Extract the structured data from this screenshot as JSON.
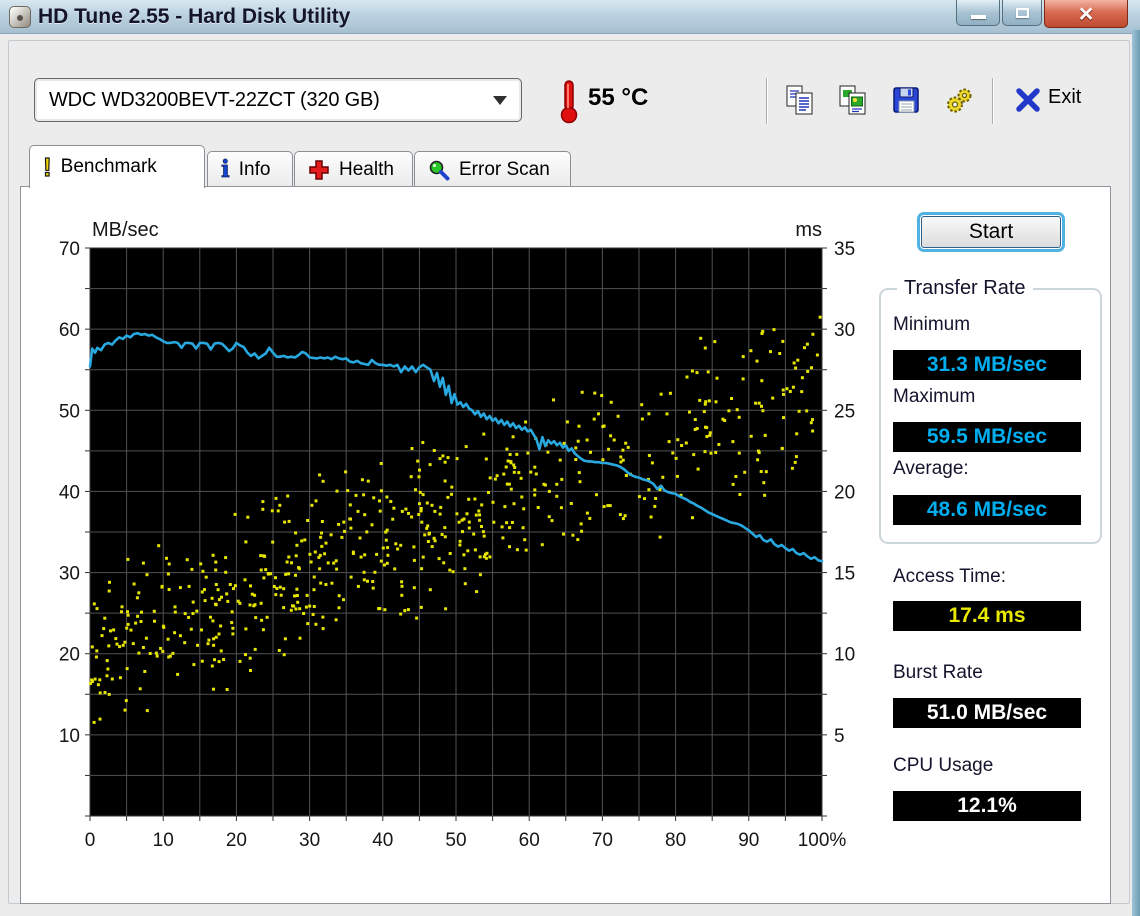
{
  "window": {
    "title": "HD Tune 2.55 - Hard Disk Utility",
    "controls": [
      {
        "name": "minimize"
      },
      {
        "name": "maximize"
      },
      {
        "name": "close"
      }
    ]
  },
  "toolbar": {
    "drive_select": {
      "value": "WDC WD3200BEVT-22ZCT (320 GB)"
    },
    "temperature": {
      "value": "55 °C"
    },
    "buttons": [
      {
        "name": "copy-text"
      },
      {
        "name": "copy-image"
      },
      {
        "name": "save-screenshot"
      },
      {
        "name": "options"
      }
    ],
    "exit_label": "Exit"
  },
  "icons": {
    "app": "hard-disk-icon",
    "temperature": "thermometer-icon",
    "toolbar": [
      "copy-text-icon",
      "copy-image-icon",
      "save-icon",
      "options-gears-icon"
    ],
    "exit": "exit-x-icon",
    "tabs": [
      "exclamation-icon",
      "info-icon",
      "health-cross-icon",
      "error-scan-magnifier-icon"
    ]
  },
  "tabs": [
    {
      "label": "Benchmark",
      "active": true
    },
    {
      "label": "Info",
      "active": false
    },
    {
      "label": "Health",
      "active": false
    },
    {
      "label": "Error Scan",
      "active": false
    }
  ],
  "benchmark": {
    "start_label": "Start",
    "transfer_rate": {
      "title": "Transfer Rate",
      "items": [
        {
          "label": "Minimum",
          "value": "31.3 MB/sec"
        },
        {
          "label": "Maximum",
          "value": "59.5 MB/sec"
        },
        {
          "label": "Average:",
          "value": "48.6 MB/sec"
        }
      ]
    },
    "stats": [
      {
        "label": "Access Time:",
        "value": "17.4 ms"
      },
      {
        "label": "Burst Rate",
        "value": "51.0 MB/sec"
      },
      {
        "label": "CPU Usage",
        "value": "12.1%"
      }
    ]
  },
  "chart_data": {
    "type": "line+scatter",
    "title": "HD Tune read benchmark",
    "left_axis": {
      "label": "MB/sec",
      "min": 0,
      "max": 70,
      "ticks": [
        70,
        60,
        50,
        40,
        30,
        20,
        10
      ]
    },
    "right_axis": {
      "label": "ms",
      "min": 0,
      "max": 35,
      "ticks": [
        35,
        30,
        25,
        20,
        15,
        10,
        5
      ]
    },
    "x_axis": {
      "min": 0,
      "max": 100,
      "ticks": [
        "0",
        "10",
        "20",
        "30",
        "40",
        "50",
        "60",
        "70",
        "80",
        "90",
        "100%"
      ]
    },
    "grid_step_x": 5,
    "grid_step_y": 5,
    "colors": {
      "bg": "#000000",
      "grid": "#525252"
    },
    "results": {
      "minimum_mbsec": 31.3,
      "maximum_mbsec": 59.5,
      "average_mbsec": 48.6,
      "access_time_ms": 17.4,
      "burst_rate_mbsec": 51.0,
      "cpu_usage_pct": 12.1
    },
    "transfer_line": {
      "name": "transfer-rate",
      "unit": "MB/sec",
      "color": "#29a8e0",
      "points": [
        [
          0,
          55.4
        ],
        [
          0.3,
          57.6
        ],
        [
          0.7,
          57.1
        ],
        [
          1,
          57.7
        ],
        [
          1.5,
          57.4
        ],
        [
          2,
          58.1
        ],
        [
          2.5,
          58.3
        ],
        [
          3,
          58.1
        ],
        [
          3.5,
          58.6
        ],
        [
          4,
          59.0
        ],
        [
          4.5,
          58.8
        ],
        [
          5,
          59.2
        ],
        [
          5.5,
          59.0
        ],
        [
          6,
          59.4
        ],
        [
          6.5,
          59.5
        ],
        [
          7,
          59.3
        ],
        [
          7.5,
          59.4
        ],
        [
          8,
          59.2
        ],
        [
          8.5,
          59.3
        ],
        [
          9,
          59.0
        ],
        [
          9.5,
          58.8
        ],
        [
          10,
          58.5
        ],
        [
          10.5,
          58.3
        ],
        [
          11,
          58.3
        ],
        [
          11.5,
          58.4
        ],
        [
          12,
          58.3
        ],
        [
          12.5,
          57.7
        ],
        [
          13,
          58.3
        ],
        [
          13.5,
          58.3
        ],
        [
          14,
          58.2
        ],
        [
          14.5,
          57.6
        ],
        [
          15,
          58.3
        ],
        [
          15.5,
          58.3
        ],
        [
          16,
          58.2
        ],
        [
          16.5,
          57.5
        ],
        [
          17,
          58.2
        ],
        [
          17.5,
          58.3
        ],
        [
          18,
          58.2
        ],
        [
          18.5,
          57.8
        ],
        [
          19,
          57.3
        ],
        [
          19.5,
          57.6
        ],
        [
          20,
          58.3
        ],
        [
          20.5,
          58.0
        ],
        [
          21,
          57.8
        ],
        [
          21.5,
          57.1
        ],
        [
          22,
          56.7
        ],
        [
          22.5,
          57.0
        ],
        [
          23,
          56.4
        ],
        [
          23.5,
          56.7
        ],
        [
          24,
          57.0
        ],
        [
          24.5,
          57.7
        ],
        [
          25,
          57.1
        ],
        [
          25.5,
          56.6
        ],
        [
          26,
          56.6
        ],
        [
          26.5,
          56.7
        ],
        [
          27,
          56.5
        ],
        [
          27.5,
          56.6
        ],
        [
          28,
          56.5
        ],
        [
          28.5,
          56.8
        ],
        [
          29,
          57.2
        ],
        [
          29.5,
          57.0
        ],
        [
          30,
          56.5
        ],
        [
          31,
          56.4
        ],
        [
          31.5,
          56.5
        ],
        [
          32,
          56.4
        ],
        [
          32.5,
          56.5
        ],
        [
          33,
          56.3
        ],
        [
          33.5,
          56.6
        ],
        [
          34,
          56.4
        ],
        [
          34.5,
          56.3
        ],
        [
          35,
          56.4
        ],
        [
          35.5,
          56.0
        ],
        [
          36,
          55.9
        ],
        [
          36.5,
          56.1
        ],
        [
          37,
          55.8
        ],
        [
          37.5,
          55.7
        ],
        [
          38,
          55.6
        ],
        [
          38.5,
          56.2
        ],
        [
          39,
          55.8
        ],
        [
          39.5,
          55.6
        ],
        [
          40,
          55.6
        ],
        [
          40.5,
          55.5
        ],
        [
          41,
          55.6
        ],
        [
          41.5,
          55.4
        ],
        [
          42,
          55.6
        ],
        [
          42.5,
          54.7
        ],
        [
          43,
          55.4
        ],
        [
          43.5,
          54.9
        ],
        [
          44,
          55.4
        ],
        [
          44.5,
          54.7
        ],
        [
          45,
          55.3
        ],
        [
          45.5,
          55.6
        ],
        [
          46,
          55.3
        ],
        [
          46.5,
          55.0
        ],
        [
          47,
          53.6
        ],
        [
          47.4,
          54.6
        ],
        [
          47.8,
          52.9
        ],
        [
          48.2,
          54.0
        ],
        [
          48.6,
          51.9
        ],
        [
          49,
          53.0
        ],
        [
          49.4,
          50.9
        ],
        [
          49.8,
          52.0
        ],
        [
          50.2,
          50.7
        ],
        [
          50.6,
          51.0
        ],
        [
          51,
          50.4
        ],
        [
          51.4,
          50.8
        ],
        [
          51.8,
          50.2
        ],
        [
          52.2,
          50.0
        ],
        [
          52.6,
          49.5
        ],
        [
          53,
          49.9
        ],
        [
          53.4,
          49.2
        ],
        [
          53.8,
          49.6
        ],
        [
          54.2,
          48.9
        ],
        [
          54.6,
          49.3
        ],
        [
          55,
          48.7
        ],
        [
          55.4,
          49.0
        ],
        [
          55.8,
          48.4
        ],
        [
          56.2,
          48.8
        ],
        [
          56.6,
          48.2
        ],
        [
          57,
          48.6
        ],
        [
          57.4,
          48.0
        ],
        [
          57.8,
          48.4
        ],
        [
          58.2,
          47.8
        ],
        [
          58.6,
          48.1
        ],
        [
          59,
          47.6
        ],
        [
          59.4,
          47.9
        ],
        [
          59.8,
          47.4
        ],
        [
          60.2,
          47.6
        ],
        [
          60.6,
          47.0
        ],
        [
          61,
          46.4
        ],
        [
          61.4,
          45.2
        ],
        [
          61.8,
          46.7
        ],
        [
          62.2,
          45.6
        ],
        [
          62.6,
          46.3
        ],
        [
          63,
          45.9
        ],
        [
          63.4,
          46.2
        ],
        [
          63.8,
          45.7
        ],
        [
          64.2,
          46.0
        ],
        [
          64.6,
          45.4
        ],
        [
          65,
          45.7
        ],
        [
          65.4,
          45.0
        ],
        [
          65.8,
          45.3
        ],
        [
          66.2,
          44.7
        ],
        [
          66.6,
          44.4
        ],
        [
          67,
          44.1
        ],
        [
          67.5,
          43.8
        ],
        [
          68,
          43.7
        ],
        [
          68.5,
          43.7
        ],
        [
          69,
          43.6
        ],
        [
          69.5,
          43.6
        ],
        [
          70,
          43.5
        ],
        [
          70.5,
          43.5
        ],
        [
          71,
          43.4
        ],
        [
          71.5,
          43.3
        ],
        [
          72,
          43.2
        ],
        [
          72.5,
          43.0
        ],
        [
          73,
          42.7
        ],
        [
          73.5,
          42.3
        ],
        [
          74,
          42.0
        ],
        [
          74.5,
          41.8
        ],
        [
          75,
          41.7
        ],
        [
          75.5,
          41.5
        ],
        [
          76,
          41.4
        ],
        [
          76.5,
          41.2
        ],
        [
          77,
          40.9
        ],
        [
          77.5,
          40.3
        ],
        [
          78,
          40.7
        ],
        [
          78.5,
          40.1
        ],
        [
          79,
          39.9
        ],
        [
          79.5,
          39.8
        ],
        [
          80,
          39.7
        ],
        [
          80.5,
          39.4
        ],
        [
          81,
          39.2
        ],
        [
          81.5,
          39.0
        ],
        [
          82,
          38.7
        ],
        [
          82.5,
          38.5
        ],
        [
          83,
          38.2
        ],
        [
          83.5,
          38.0
        ],
        [
          84,
          37.7
        ],
        [
          84.5,
          37.4
        ],
        [
          85,
          37.2
        ],
        [
          85.5,
          37.0
        ],
        [
          86,
          36.8
        ],
        [
          86.5,
          36.6
        ],
        [
          87,
          36.4
        ],
        [
          87.5,
          36.2
        ],
        [
          88,
          36.1
        ],
        [
          88.5,
          36.0
        ],
        [
          89,
          35.8
        ],
        [
          89.5,
          35.5
        ],
        [
          90,
          35.2
        ],
        [
          90.5,
          34.8
        ],
        [
          91,
          34.4
        ],
        [
          91.5,
          34.6
        ],
        [
          92,
          34.0
        ],
        [
          92.5,
          33.8
        ],
        [
          93,
          34.1
        ],
        [
          93.5,
          33.5
        ],
        [
          94,
          33.2
        ],
        [
          94.5,
          33.4
        ],
        [
          95,
          33.0
        ],
        [
          95.5,
          32.7
        ],
        [
          96,
          32.9
        ],
        [
          96.5,
          32.4
        ],
        [
          97,
          32.2
        ],
        [
          97.5,
          32.4
        ],
        [
          98,
          32.0
        ],
        [
          98.5,
          31.7
        ],
        [
          99,
          31.9
        ],
        [
          99.5,
          31.5
        ],
        [
          100,
          31.4
        ]
      ]
    },
    "access_scatter": {
      "name": "access-time-dots",
      "unit": "plotted on left-axis scale (ms value = y/2 on right axis)",
      "color": "#e6e600",
      "count": 650,
      "seed": 1337420,
      "left_frac": 0.7,
      "split": 60,
      "base": 20,
      "slope": 0.33,
      "spread": 12,
      "ymin": 3,
      "ymax": 64
    }
  }
}
